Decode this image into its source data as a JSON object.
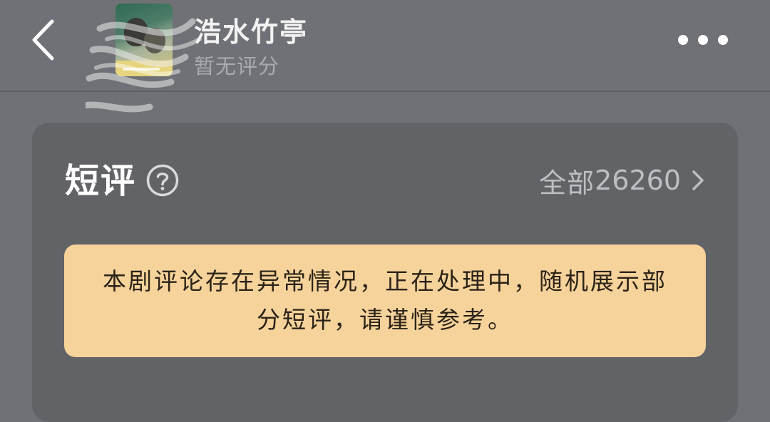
{
  "header": {
    "back_icon": "chevron-left-icon",
    "title": "浩水竹亭",
    "rating_text": "暂无评分",
    "more_icon": "more-horizontal-icon",
    "poster_icon": "drama-poster-image"
  },
  "short_reviews": {
    "title": "短评",
    "help_icon": "question-circle-icon",
    "view_all_label": "全部",
    "view_all_count": "26260",
    "view_all_icon": "chevron-right-icon",
    "notice": "本剧评论存在异常情况，正在处理中，随机展示部分短评，请谨慎参考。"
  },
  "colors": {
    "background": "#6f7176",
    "card": "#626367",
    "notice_background": "#f6d39b",
    "notice_text": "#2b2317"
  }
}
